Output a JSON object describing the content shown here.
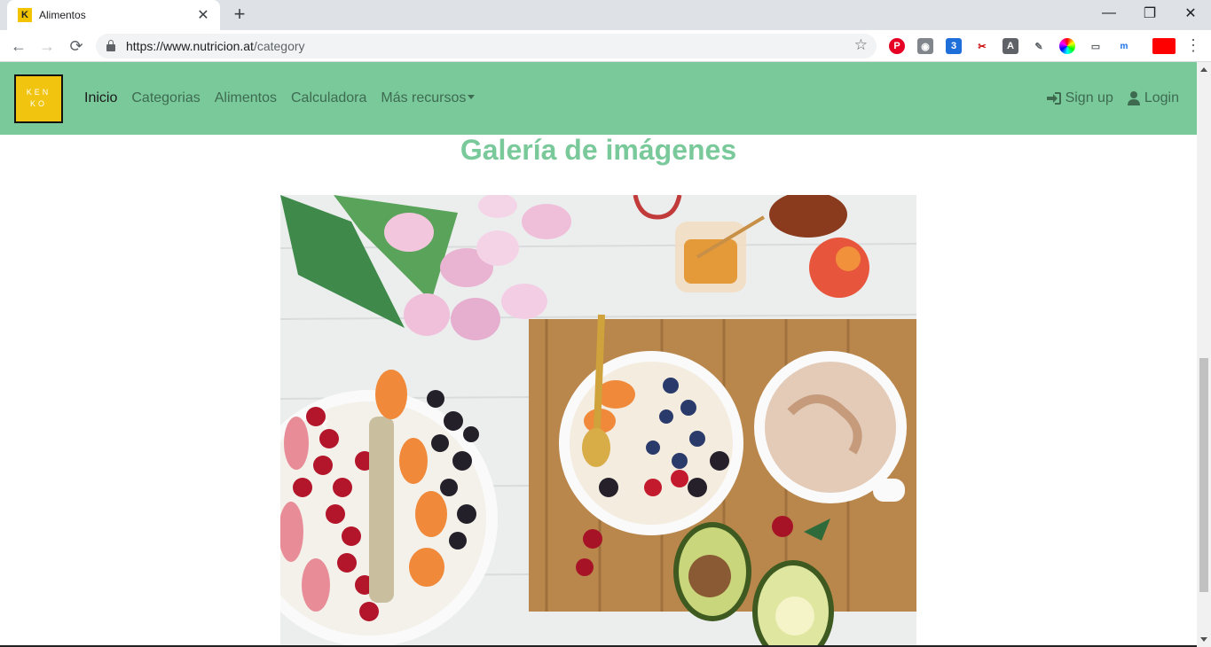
{
  "browser": {
    "tab_title": "Alimentos",
    "favicon_text": "K",
    "url_host": "https://www.nutricion.at",
    "url_path": "/category"
  },
  "navbar": {
    "brand_line1": "KEN",
    "brand_line2": "KO",
    "links": [
      "Inicio",
      "Categorias",
      "Alimentos",
      "Calculadora",
      "Más recursos"
    ],
    "signup": "Sign up",
    "login": "Login"
  },
  "main": {
    "gallery_title": "Galería de imágenes",
    "carousel_prev_glyph": "‹"
  },
  "colors": {
    "accent": "#7ac99b",
    "brand_bg": "#f1c40f"
  }
}
